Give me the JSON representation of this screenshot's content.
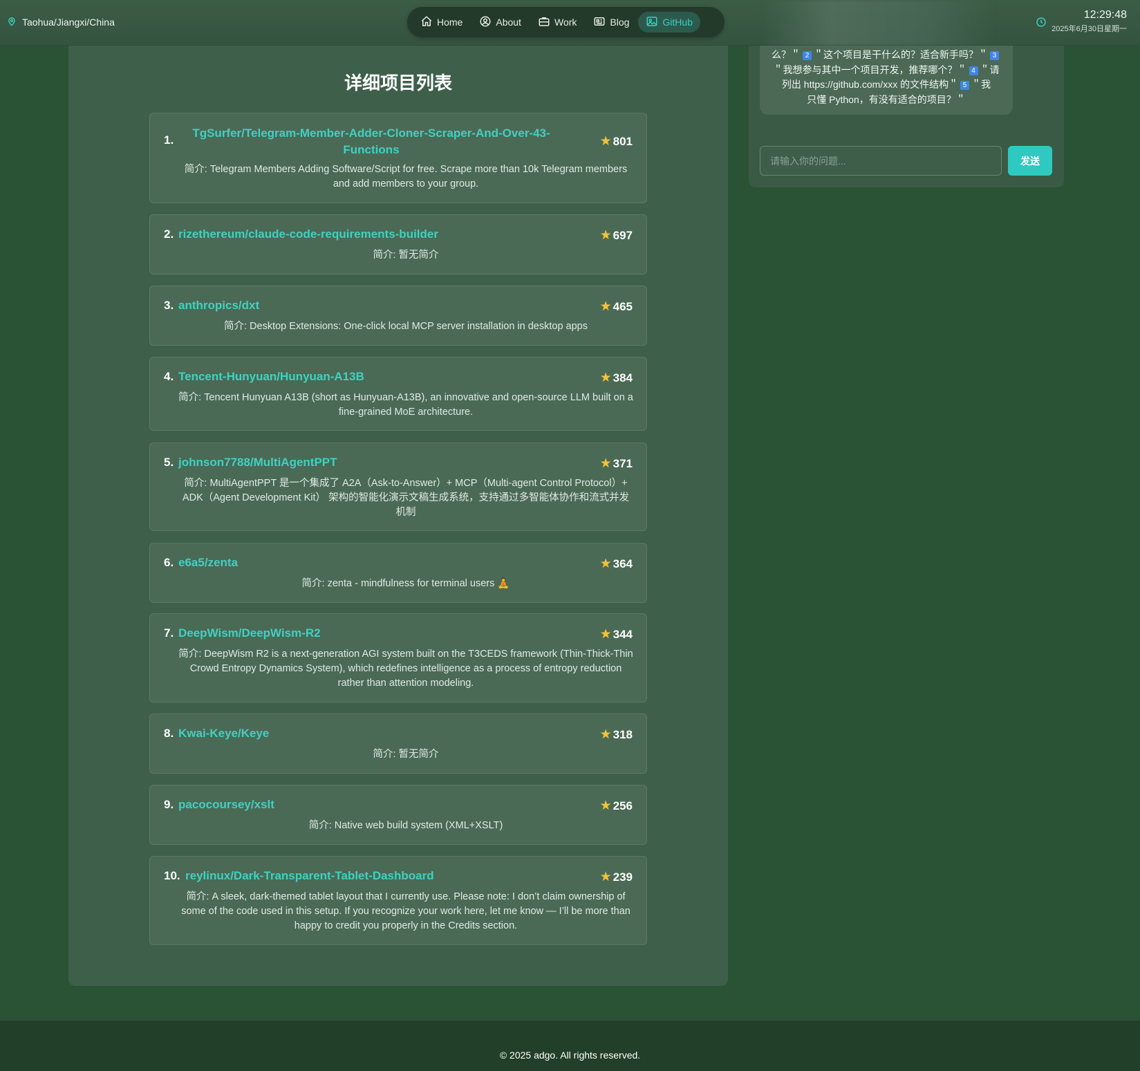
{
  "header": {
    "location": "Taohua/Jiangxi/China",
    "nav": [
      {
        "label": "Home",
        "icon": "home-icon"
      },
      {
        "label": "About",
        "icon": "user-circle-icon"
      },
      {
        "label": "Work",
        "icon": "briefcase-icon"
      },
      {
        "label": "Blog",
        "icon": "newspaper-icon"
      },
      {
        "label": "GitHub",
        "icon": "image-icon",
        "active": true
      }
    ],
    "time": "12:29:48",
    "date": "2025年6月30日星期一"
  },
  "main": {
    "title": "详细项目列表",
    "projects": [
      {
        "rank": "1.",
        "repo": "TgSurfer/Telegram-Member-Adder-Cloner-Scraper-And-Over-43-Functions",
        "repo_line1": "TgSurfer/Telegram-Member-Adder-Cloner-Scraper-And-Over-43-",
        "repo_line2": "Functions",
        "stars": "801",
        "desc": "简介: Telegram Members Adding Software/Script for free. Scrape more than 10k Telegram members and add members to your group."
      },
      {
        "rank": "2.",
        "repo": "rizethereum/claude-code-requirements-builder",
        "stars": "697",
        "desc": "简介: 暂无简介"
      },
      {
        "rank": "3.",
        "repo": "anthropics/dxt",
        "stars": "465",
        "desc": "简介: Desktop Extensions: One-click local MCP server installation in desktop apps"
      },
      {
        "rank": "4.",
        "repo": "Tencent-Hunyuan/Hunyuan-A13B",
        "stars": "384",
        "desc": "简介: Tencent Hunyuan A13B (short as Hunyuan-A13B), an innovative and open-source LLM built on a fine-grained MoE architecture."
      },
      {
        "rank": "5.",
        "repo": "johnson7788/MultiAgentPPT",
        "stars": "371",
        "desc": "简介: MultiAgentPPT 是一个集成了 A2A（Ask-to-Answer）+ MCP（Multi-agent Control Protocol）+ ADK（Agent Development Kit） 架构的智能化演示文稿生成系统，支持通过多智能体协作和流式并发机制"
      },
      {
        "rank": "6.",
        "repo": "e6a5/zenta",
        "stars": "364",
        "desc": "简介: zenta - mindfulness for terminal users 🧘"
      },
      {
        "rank": "7.",
        "repo": "DeepWism/DeepWism-R2",
        "stars": "344",
        "desc": "简介: DeepWism R2 is a next-generation AGI system built on the T3CEDS framework (Thin-Thick-Thin Crowd Entropy Dynamics System), which redefines intelligence as a process of entropy reduction rather than attention modeling."
      },
      {
        "rank": "8.",
        "repo": "Kwai-Keye/Keye",
        "stars": "318",
        "desc": "简介: 暂无简介"
      },
      {
        "rank": "9.",
        "repo": "pacocoursey/xslt",
        "stars": "256",
        "desc": "简介: Native web build system (XML+XSLT)"
      },
      {
        "rank": "10.",
        "repo": "reylinux/Dark-Transparent-Tablet-Dashboard",
        "stars": "239",
        "desc": "简介: A sleek, dark-themed tablet layout that I currently use. Please note: I don’t claim ownership of some of the code used in this setup. If you recognize your work here, let me know — I’ll be more than happy to credit you properly in the Credits section."
      }
    ]
  },
  "chat": {
    "bubble_line1_a": "么？＂",
    "badge2": "2",
    "bubble_line1_b": "＂这个项目是干什么的？适合新手吗？＂",
    "badge3": "3",
    "bubble_line2_a": "＂我想参与其中一个项目开发，推荐哪个？＂",
    "badge4": "4",
    "bubble_line2_b": "＂请",
    "bubble_line3_a": "列出 https://github.com/xxx 的文件结构＂",
    "badge5": "5",
    "bubble_line3_b": "＂我",
    "bubble_line4": "只懂 Python，有没有适合的项目？＂",
    "input_placeholder": "请输入你的问题...",
    "send_label": "发送"
  },
  "footer": {
    "copyright": "© 2025 adgo. All rights reserved."
  },
  "colors": {
    "accent": "#3fd1c2",
    "background": "#2a5234",
    "panel": "#3e5f4a",
    "star": "#f2c23a"
  }
}
